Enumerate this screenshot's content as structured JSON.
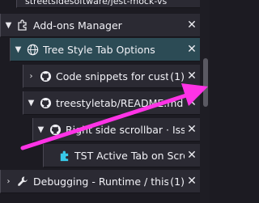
{
  "tabs": [
    {
      "label": "streetsidesoftware/jest-mock-vs",
      "icon": "github-icon",
      "twisty": ""
    },
    {
      "label": "Add-ons Manager",
      "icon": "puzzle-icon",
      "twisty": "▼"
    },
    {
      "label": "Tree Style Tab Options",
      "icon": "globe-icon",
      "twisty": "▼"
    },
    {
      "label": "Code snippets for custom",
      "icon": "github-icon",
      "twisty": "›",
      "count": "(1)"
    },
    {
      "label": "treestyletab/README.md",
      "icon": "github-icon",
      "twisty": "▼"
    },
    {
      "label": "Right side scrollbar · Issue",
      "icon": "github-icon",
      "twisty": "▼"
    },
    {
      "label": "TST Active Tab on Scroll",
      "icon": "puzzle-piece-icon",
      "twisty": ""
    },
    {
      "label": "Debugging - Runtime / this-fi",
      "icon": "wrench-icon",
      "twisty": "›",
      "count": "(1)"
    }
  ],
  "colors": {
    "background": "#1c1b22",
    "tab": "#2b2a33",
    "active_tab": "#2c4b55",
    "annotation_arrow": "#ff33e6",
    "tst_icon": "#38c9e8"
  }
}
